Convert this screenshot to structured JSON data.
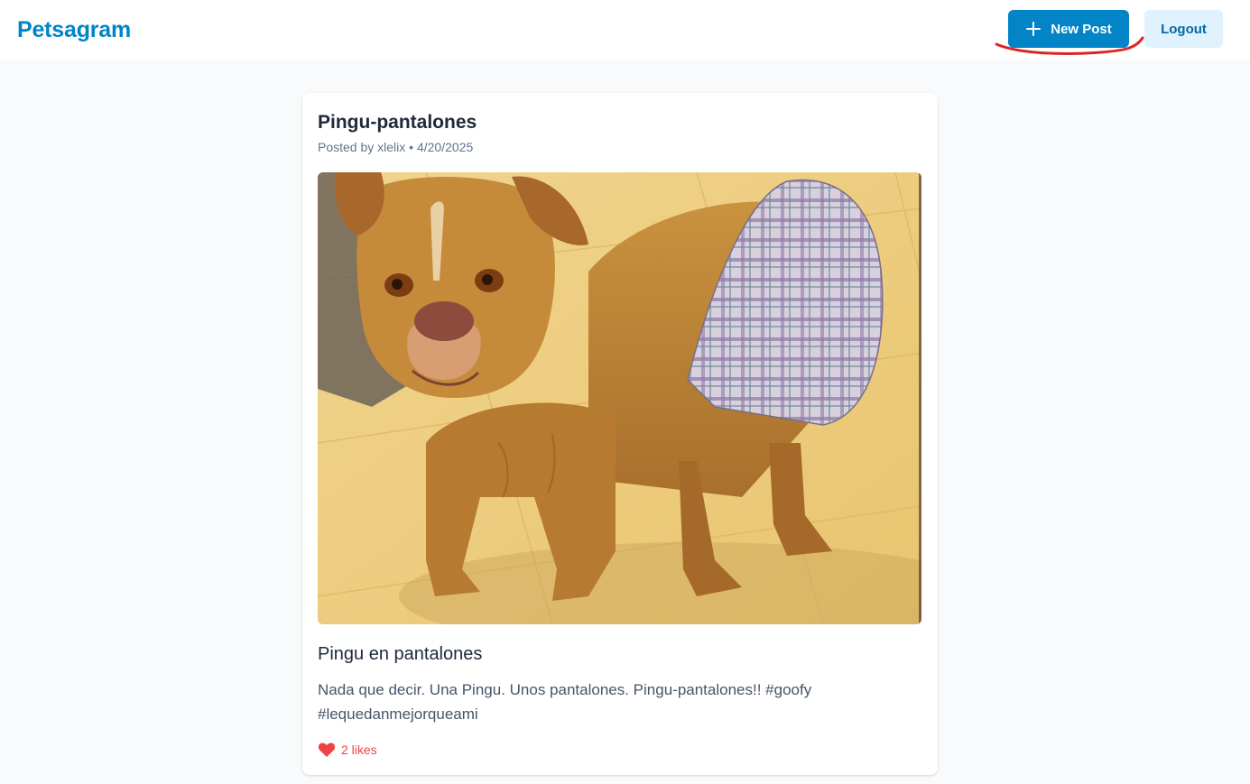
{
  "header": {
    "brand": "Petsagram",
    "new_post_label": "New Post",
    "logout_label": "Logout"
  },
  "post": {
    "title": "Pingu-pantalones",
    "meta": "Posted by xlelix • 4/20/2025",
    "caption": "Pingu en pantalones",
    "description": "Nada que decir. Una Pingu. Unos pantalones. Pingu-pantalones!! #goofy #lequedanmejorqueami",
    "likes_text": "2 likes"
  },
  "icons": {
    "new_post": "plus-icon",
    "likes": "heart-icon"
  },
  "colors": {
    "brand": "#0284c7",
    "primary_button": "#0284c7",
    "secondary_button": "#e0f2fe",
    "like": "#ef4444",
    "annotation": "#dc2626"
  }
}
